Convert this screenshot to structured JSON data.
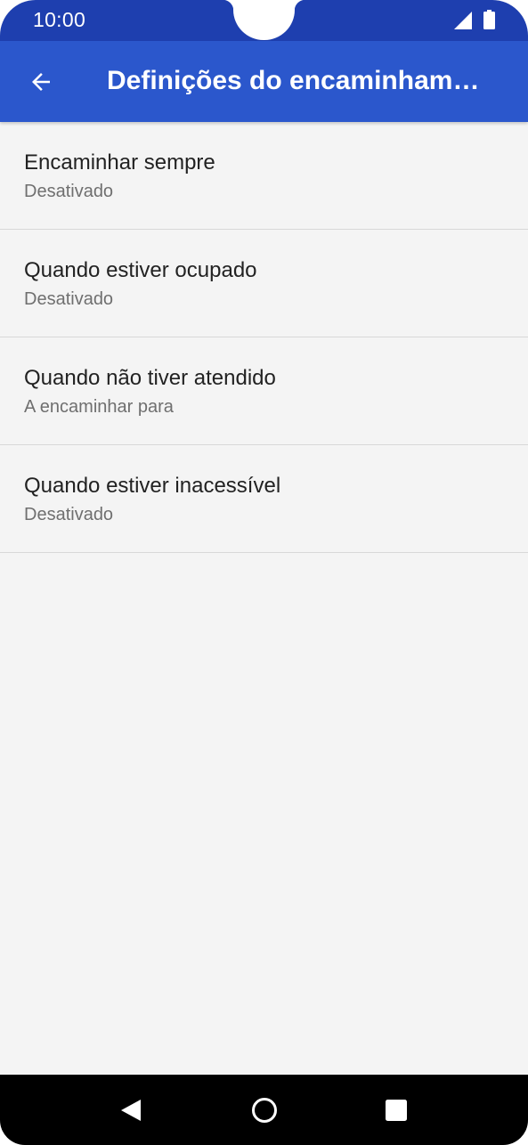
{
  "status_bar": {
    "time": "10:00",
    "icons": [
      "signal-icon",
      "battery-icon"
    ]
  },
  "app_bar": {
    "back_icon": "arrow-left-icon",
    "title": "Definições do encaminhamento de chamadas"
  },
  "settings": {
    "items": [
      {
        "title": "Encaminhar sempre",
        "summary": "Desativado"
      },
      {
        "title": "Quando estiver ocupado",
        "summary": "Desativado"
      },
      {
        "title": "Quando não tiver atendido",
        "summary": "A encaminhar para"
      },
      {
        "title": "Quando estiver inacessível",
        "summary": "Desativado"
      }
    ]
  },
  "nav_bar": {
    "icons": [
      "back-triangle-icon",
      "home-circle-icon",
      "recents-square-icon"
    ]
  },
  "colors": {
    "status_bar": "#1e3faf",
    "app_bar": "#2b57cc",
    "background": "#f4f4f4",
    "divider": "#d8d8d8"
  }
}
